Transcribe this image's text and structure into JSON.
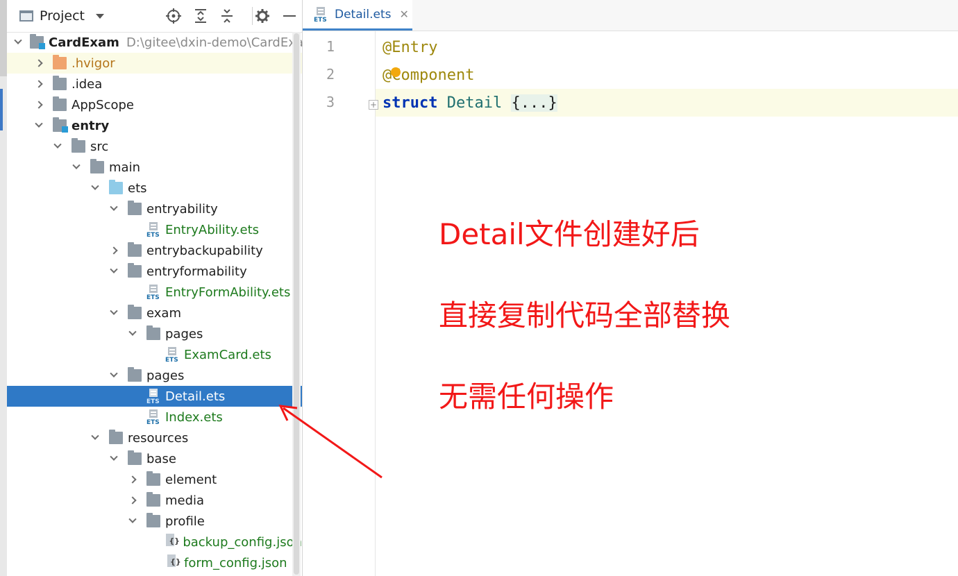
{
  "project_panel": {
    "title": "Project",
    "tree": [
      {
        "name": "CardExam",
        "path": "D:\\gitee\\dxin-demo\\CardExam",
        "type": "module",
        "expanded": true,
        "bold": true
      },
      {
        "name": ".hvigor",
        "type": "folder-orange",
        "expanded": false,
        "color": "orange"
      },
      {
        "name": ".idea",
        "type": "folder",
        "expanded": false
      },
      {
        "name": "AppScope",
        "type": "folder",
        "expanded": false
      },
      {
        "name": "entry",
        "type": "module",
        "expanded": true,
        "bold": true
      },
      {
        "name": "src",
        "type": "folder",
        "expanded": true
      },
      {
        "name": "main",
        "type": "folder",
        "expanded": true
      },
      {
        "name": "ets",
        "type": "folder-blue",
        "expanded": true
      },
      {
        "name": "entryability",
        "type": "folder",
        "expanded": true
      },
      {
        "name": "EntryAbility.ets",
        "type": "ets"
      },
      {
        "name": "entrybackupability",
        "type": "folder",
        "expanded": false
      },
      {
        "name": "entryformability",
        "type": "folder",
        "expanded": true
      },
      {
        "name": "EntryFormAbility.ets",
        "type": "ets"
      },
      {
        "name": "exam",
        "type": "folder",
        "expanded": true
      },
      {
        "name": "pages",
        "type": "folder",
        "expanded": true
      },
      {
        "name": "ExamCard.ets",
        "type": "ets"
      },
      {
        "name": "pages",
        "type": "folder",
        "expanded": true
      },
      {
        "name": "Detail.ets",
        "type": "ets",
        "selected": true
      },
      {
        "name": "Index.ets",
        "type": "ets"
      },
      {
        "name": "resources",
        "type": "folder",
        "expanded": true
      },
      {
        "name": "base",
        "type": "folder",
        "expanded": true
      },
      {
        "name": "element",
        "type": "folder",
        "expanded": false
      },
      {
        "name": "media",
        "type": "folder",
        "expanded": false
      },
      {
        "name": "profile",
        "type": "folder",
        "expanded": true
      },
      {
        "name": "backup_config.json",
        "type": "json"
      },
      {
        "name": "form_config.json",
        "type": "json"
      }
    ]
  },
  "editor": {
    "active_tab": "Detail.ets",
    "line_numbers": [
      "1",
      "2",
      "3"
    ],
    "code": {
      "line1": "@Entry",
      "line2": "@Component",
      "line3_kw": "struct",
      "line3_name": "Detail",
      "line3_fold": "{...}"
    }
  },
  "annotation": {
    "lines": [
      "Detail文件创建好后",
      "直接复制代码全部替换",
      "无需任何操作"
    ],
    "color": "#f21818"
  },
  "colors": {
    "selection": "#2f79c6",
    "file_green": "#1d7a1d",
    "annotation_keyword": "#9e880d",
    "keyword": "#0033b3"
  }
}
